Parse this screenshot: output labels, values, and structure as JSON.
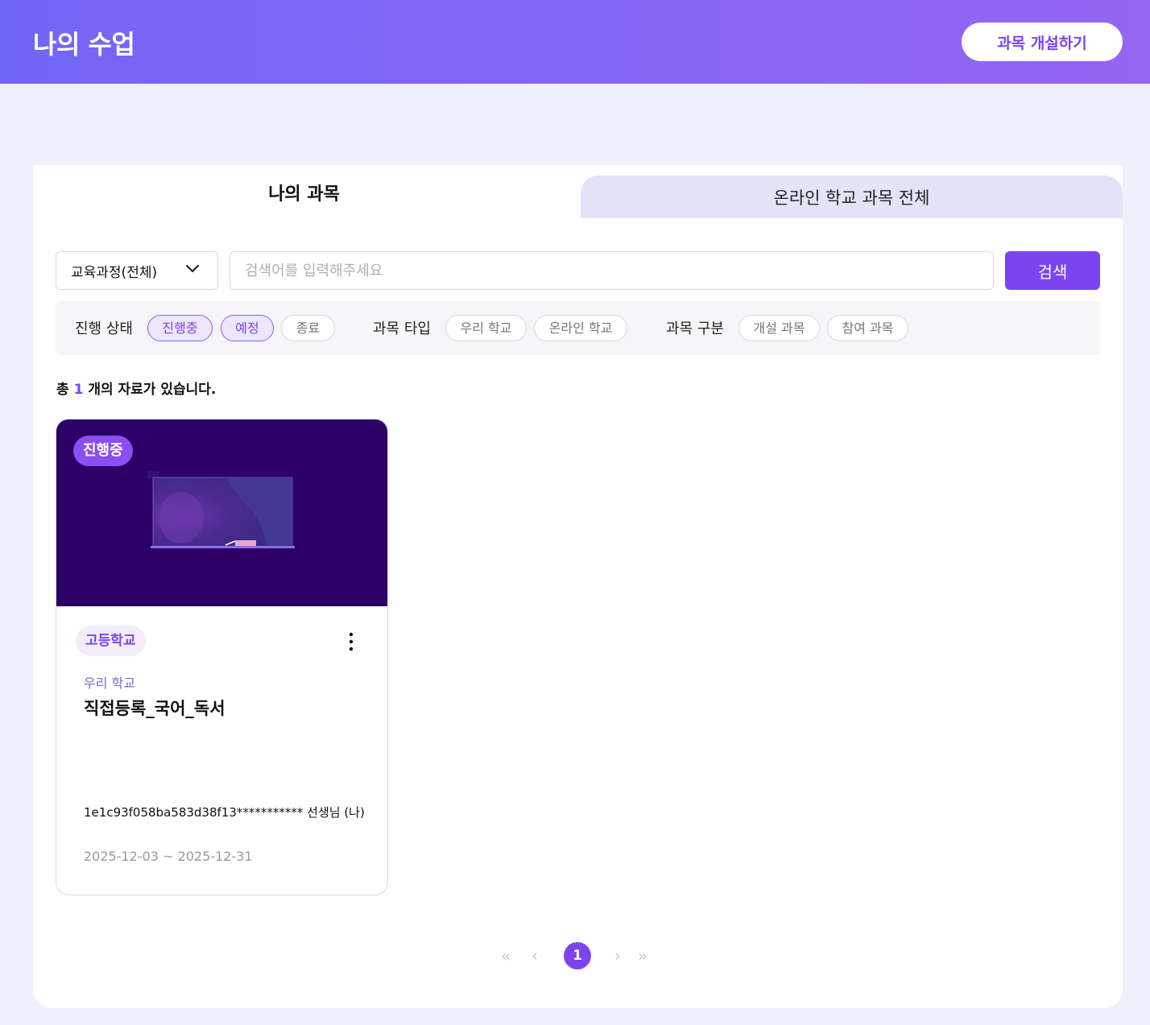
{
  "header": {
    "title": "나의 수업",
    "create_label": "과목 개설하기"
  },
  "tabs": [
    {
      "label": "나의 과목",
      "active": true
    },
    {
      "label": "온라인 학교 과목 전체",
      "active": false
    }
  ],
  "search": {
    "select_value": "교육과정(전체)",
    "placeholder": "검색어를 입력해주세요",
    "button_label": "검색"
  },
  "filters": {
    "status": {
      "label": "진행 상태",
      "options": [
        "진행중",
        "예정",
        "종료"
      ]
    },
    "type": {
      "label": "과목 타입",
      "options": [
        "우리 학교",
        "온라인 학교"
      ]
    },
    "category": {
      "label": "과목 구분",
      "options": [
        "개설 과목",
        "참여 과목"
      ]
    }
  },
  "total": {
    "prefix": "총",
    "count": "1",
    "suffix": "개의 자료가 있습니다."
  },
  "courses": [
    {
      "status": "진행중",
      "level": "고등학교",
      "type": "우리 학교",
      "title": "직접등록_국어_독서",
      "teacher": "1e1c93f058ba583d38f13*********** 선생님 (나)",
      "period": "2025-12-03 ~ 2025-12-31"
    }
  ],
  "pagination": {
    "current": "1",
    "first_icon": "«",
    "prev_icon": "‹",
    "next_icon": "›",
    "last_icon": "»"
  },
  "colors": {
    "accent": "#7c44f0",
    "header_start": "#7266f6",
    "header_end": "#9466f2",
    "thumb_bg": "#2c0066"
  }
}
